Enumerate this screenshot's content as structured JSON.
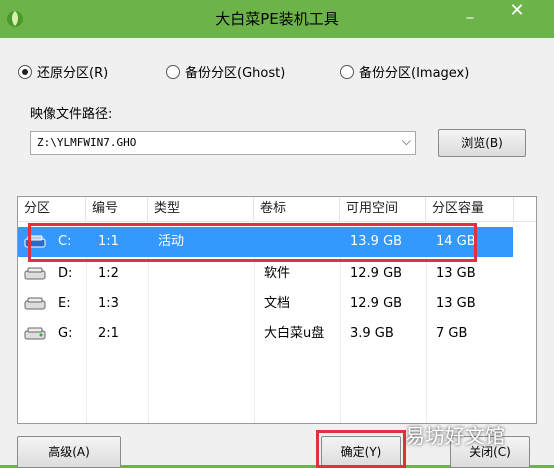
{
  "window": {
    "title": "大白菜PE装机工具",
    "minimize": "_",
    "close": "✕"
  },
  "mode": {
    "options": [
      {
        "label": "还原分区(R)",
        "selected": true
      },
      {
        "label": "备份分区(Ghost)",
        "selected": false
      },
      {
        "label": "备份分区(Imagex)",
        "selected": false
      }
    ]
  },
  "image": {
    "label": "映像文件路径:",
    "path": "Z:\\YLMFWIN7.GHO",
    "browse": "浏览(B)"
  },
  "table": {
    "headers": [
      "分区",
      "编号",
      "类型",
      "卷标",
      "可用空间",
      "分区容量"
    ],
    "rows": [
      {
        "part": "C:",
        "num": "1:1",
        "type": "活动",
        "label": "",
        "free": "13.9 GB",
        "size": "14 GB",
        "selected": true
      },
      {
        "part": "D:",
        "num": "1:2",
        "type": "",
        "label": "软件",
        "free": "12.9 GB",
        "size": "13 GB",
        "selected": false
      },
      {
        "part": "E:",
        "num": "1:3",
        "type": "",
        "label": "文档",
        "free": "12.9 GB",
        "size": "13 GB",
        "selected": false
      },
      {
        "part": "G:",
        "num": "2:1",
        "type": "",
        "label": "大白菜u盘",
        "free": "3.9 GB",
        "size": "7 GB",
        "selected": false
      }
    ]
  },
  "buttons": {
    "advanced": "高级(A)",
    "ok": "确定(Y)",
    "close": "关闭(C)"
  },
  "watermark": "易坊好文馆",
  "colors": {
    "title_bar": "#6cb44a",
    "selection": "#3399ff",
    "highlight_box": "#e0313c"
  }
}
